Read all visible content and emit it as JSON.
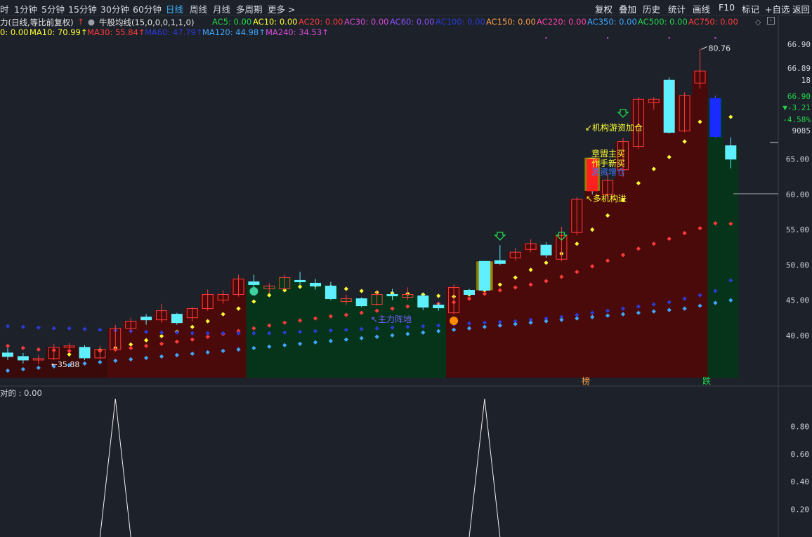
{
  "toolbar": {
    "left": [
      {
        "label": "时",
        "active": false
      },
      {
        "label": "1分钟",
        "active": false
      },
      {
        "label": "5分钟",
        "active": false
      },
      {
        "label": "15分钟",
        "active": false
      },
      {
        "label": "30分钟",
        "active": false
      },
      {
        "label": "60分钟",
        "active": false
      },
      {
        "label": "日线",
        "active": true
      },
      {
        "label": "周线",
        "active": false
      },
      {
        "label": "月线",
        "active": false
      },
      {
        "label": "多周期",
        "active": false
      },
      {
        "label": "更多 >",
        "active": false
      }
    ],
    "right": [
      "复权",
      "叠加",
      "历史",
      "统计",
      "画线",
      "F10",
      "标记",
      "+自选",
      "返回"
    ]
  },
  "indicator_row1": {
    "title": "力(日线,等比前复权)",
    "formula": "牛股均线(15,0,0,0,1,1,0)",
    "items": [
      {
        "text": "AC5: 0.00",
        "color": "#22d64a"
      },
      {
        "text": "AC10: 0.00",
        "color": "#ffff33"
      },
      {
        "text": "AC20: 0.00",
        "color": "#ff3b3b"
      },
      {
        "text": "AC30: 0.00",
        "color": "#d94bd9"
      },
      {
        "text": "AC60: 0.00",
        "color": "#8a50ff"
      },
      {
        "text": "AC100: 0.00",
        "color": "#2b3bd9"
      },
      {
        "text": "AC150: 0.00",
        "color": "#ffa046"
      },
      {
        "text": "AC220: 0.00",
        "color": "#ff44aa"
      },
      {
        "text": "AC350: 0.00",
        "color": "#3fa8ff"
      },
      {
        "text": "AC500: 0.00",
        "color": "#22d64a"
      },
      {
        "text": "AC750: 0.00",
        "color": "#ff3b3b"
      }
    ]
  },
  "indicator_row2": {
    "items": [
      {
        "text": "0: 0.00",
        "color": "#ffff33"
      },
      {
        "text": "MA10: 70.99↑",
        "color": "#ffff33"
      },
      {
        "text": "MA30: 55.84↑",
        "color": "#ff3b3b"
      },
      {
        "text": "MA60: 47.79↑",
        "color": "#2b3bd9"
      },
      {
        "text": "MA120: 44.98↑",
        "color": "#3fa8ff"
      },
      {
        "text": "MA240: 34.53↑",
        "color": "#d94bd9"
      }
    ]
  },
  "price_axis": {
    "ticks": [
      "65.00",
      "60.00",
      "55.00",
      "50.00",
      "45.00",
      "40.00"
    ],
    "top_labels": [
      {
        "text": "66.90",
        "color": "#cfd3dc"
      },
      {
        "text": "66.89",
        "color": "#cfd3dc"
      },
      {
        "text": "18",
        "color": "#cfd3dc"
      },
      {
        "text": "66.90",
        "color": "#22d64a"
      },
      {
        "text": "▼-3.21",
        "color": "#22d64a"
      },
      {
        "text": "-4.58%",
        "color": "#22d64a"
      },
      {
        "text": "9085",
        "color": "#cfd3dc"
      }
    ]
  },
  "annotations": {
    "high_label": "80.76",
    "low_label": "35.88",
    "signals": [
      {
        "text": "↙机构游资加仓",
        "color": "#ffff33"
      },
      {
        "text": "章盟主买",
        "color": "#ffff33"
      },
      {
        "text": "作手新买",
        "color": "#ffff33"
      },
      {
        "text": "游资增仓",
        "color": "#3f7bff"
      },
      {
        "text": "↖多机构进",
        "color": "#ffff33"
      },
      {
        "text": "↖主力阵地",
        "color": "#7a5cff"
      }
    ],
    "badges": [
      {
        "text": "榜",
        "color": "#ffa046"
      },
      {
        "text": "跌",
        "color": "#22d64a"
      }
    ]
  },
  "sub_chart": {
    "title": "对的 : 0.00",
    "ticks": [
      "0.80",
      "0.60",
      "0.40",
      "0.20"
    ]
  },
  "colors": {
    "up_candle": "#ff3b3b",
    "down_candle": "#5ff0ff",
    "bg": "#1d212a",
    "red_zone": "#4a0a0a",
    "green_zone": "#06341a"
  },
  "chart_data": {
    "type": "candlestick",
    "ylim": [
      34.0,
      82.0
    ],
    "candles": [
      [
        37.5,
        37.0,
        38.2,
        36.5
      ],
      [
        37.0,
        36.5,
        37.5,
        36.0
      ],
      [
        36.5,
        36.7,
        37.2,
        35.9
      ],
      [
        36.7,
        38.3,
        38.8,
        36.5
      ],
      [
        38.3,
        38.5,
        38.9,
        37.5
      ],
      [
        38.3,
        36.8,
        38.6,
        36.5
      ],
      [
        36.8,
        38.0,
        38.5,
        36.6
      ],
      [
        38.0,
        41.0,
        41.5,
        37.8
      ],
      [
        41.0,
        42.0,
        42.5,
        40.5
      ],
      [
        42.6,
        42.2,
        43.0,
        41.5
      ],
      [
        42.2,
        43.5,
        44.5,
        41.8
      ],
      [
        43.0,
        41.8,
        43.2,
        41.5
      ],
      [
        42.5,
        43.8,
        44.0,
        42.0
      ],
      [
        43.8,
        45.8,
        46.5,
        43.5
      ],
      [
        45.0,
        45.8,
        46.4,
        44.5
      ],
      [
        45.8,
        48.0,
        48.6,
        45.5
      ],
      [
        47.6,
        47.2,
        48.6,
        46.8
      ],
      [
        46.6,
        47.0,
        47.4,
        46.0
      ],
      [
        46.6,
        48.2,
        48.6,
        46.4
      ],
      [
        47.8,
        47.6,
        49.0,
        47.2
      ],
      [
        47.4,
        47.0,
        48.0,
        46.5
      ],
      [
        47.0,
        45.2,
        47.6,
        45.0
      ],
      [
        44.8,
        45.2,
        45.8,
        44.3
      ],
      [
        45.2,
        44.2,
        45.4,
        44.0
      ],
      [
        44.4,
        45.8,
        46.4,
        44.2
      ],
      [
        45.8,
        45.6,
        46.6,
        45.0
      ],
      [
        45.4,
        45.8,
        46.8,
        45.0
      ],
      [
        45.6,
        44.0,
        46.0,
        43.6
      ],
      [
        44.3,
        43.9,
        44.6,
        43.5
      ],
      [
        43.2,
        46.8,
        47.2,
        43.0
      ],
      [
        46.4,
        45.8,
        46.6,
        45.6
      ],
      [
        50.5,
        46.4,
        50.5,
        46.4
      ],
      [
        50.6,
        50.2,
        52.8,
        50.0
      ],
      [
        51.0,
        51.8,
        52.4,
        50.6
      ],
      [
        52.2,
        53.0,
        53.6,
        51.8
      ],
      [
        52.8,
        51.4,
        53.2,
        51.0
      ],
      [
        50.8,
        54.2,
        55.4,
        50.5
      ],
      [
        54.6,
        59.3,
        59.6,
        54.2
      ],
      [
        65.0,
        60.5,
        65.2,
        60.0
      ],
      [
        60.0,
        62.0,
        63.0,
        59.5
      ],
      [
        63.5,
        67.5,
        68.0,
        62.5
      ],
      [
        66.8,
        73.5,
        73.8,
        66.5
      ],
      [
        73.0,
        73.5,
        73.8,
        72.0
      ],
      [
        76.2,
        68.8,
        76.6,
        68.6
      ],
      [
        69.0,
        74.0,
        74.5,
        68.8
      ],
      [
        75.8,
        77.5,
        80.7,
        75.0
      ],
      [
        73.6,
        68.2,
        74.0,
        68.0
      ],
      [
        66.9,
        65.0,
        68.1,
        63.7
      ]
    ],
    "series": [
      {
        "name": "MA10",
        "color": "#ffff33",
        "values": [
          null,
          null,
          null,
          null,
          37.3,
          37.6,
          37.9,
          38.2,
          38.7,
          39.3,
          39.9,
          40.5,
          41.2,
          42.0,
          43.0,
          43.8,
          44.8,
          45.7,
          46.4,
          46.9,
          47.1,
          46.9,
          46.6,
          46.3,
          46.1,
          46.0,
          45.9,
          45.8,
          45.6,
          45.5,
          45.8,
          46.4,
          47.2,
          48.2,
          49.3,
          50.3,
          51.6,
          53.0,
          55.0,
          57.0,
          59.2,
          61.6,
          63.6,
          65.3,
          67.5,
          70.3,
          72.4,
          70.99
        ]
      },
      {
        "name": "MA30",
        "color": "#ff3b3b",
        "values": [
          38.5,
          38.2,
          38.0,
          37.9,
          37.8,
          37.8,
          37.8,
          38.0,
          38.2,
          38.5,
          38.8,
          39.1,
          39.4,
          39.8,
          40.2,
          40.6,
          41.0,
          41.4,
          41.8,
          42.1,
          42.4,
          42.7,
          42.9,
          43.2,
          43.5,
          43.8,
          44.1,
          44.3,
          44.5,
          44.7,
          45.2,
          45.9,
          46.4,
          46.8,
          47.2,
          47.7,
          48.3,
          49.0,
          49.8,
          50.6,
          51.4,
          52.3,
          53.0,
          53.7,
          54.5,
          55.2,
          55.9,
          55.84
        ]
      },
      {
        "name": "MA60",
        "color": "#2b3bd9",
        "values": [
          41.3,
          41.2,
          41.1,
          41.0,
          41.0,
          40.9,
          40.8,
          40.7,
          40.6,
          40.5,
          40.4,
          40.4,
          40.3,
          40.3,
          40.3,
          40.3,
          40.3,
          40.3,
          40.4,
          40.5,
          40.6,
          40.7,
          40.8,
          40.9,
          41.0,
          41.1,
          41.2,
          41.3,
          41.4,
          41.6,
          41.7,
          41.8,
          41.9,
          42.0,
          42.2,
          42.4,
          42.6,
          42.9,
          43.2,
          43.5,
          43.8,
          44.1,
          44.4,
          44.7,
          45.2,
          45.7,
          46.3,
          47.79
        ]
      },
      {
        "name": "MA120",
        "color": "#3fa8ff",
        "values": [
          35.0,
          35.2,
          35.4,
          35.6,
          35.8,
          36.0,
          36.2,
          36.4,
          36.6,
          36.8,
          37.0,
          37.2,
          37.4,
          37.6,
          37.8,
          38.0,
          38.2,
          38.4,
          38.6,
          38.8,
          39.0,
          39.2,
          39.4,
          39.6,
          39.8,
          40.0,
          40.2,
          40.4,
          40.6,
          40.8,
          41.0,
          41.2,
          41.4,
          41.6,
          41.8,
          42.0,
          42.2,
          42.4,
          42.6,
          42.8,
          43.0,
          43.2,
          43.4,
          43.6,
          43.8,
          44.2,
          44.6,
          44.98
        ]
      }
    ],
    "sub_series": {
      "ylim": [
        0,
        1.0
      ],
      "spikes_at_candle": [
        7,
        31
      ],
      "peak": 1.0
    }
  }
}
